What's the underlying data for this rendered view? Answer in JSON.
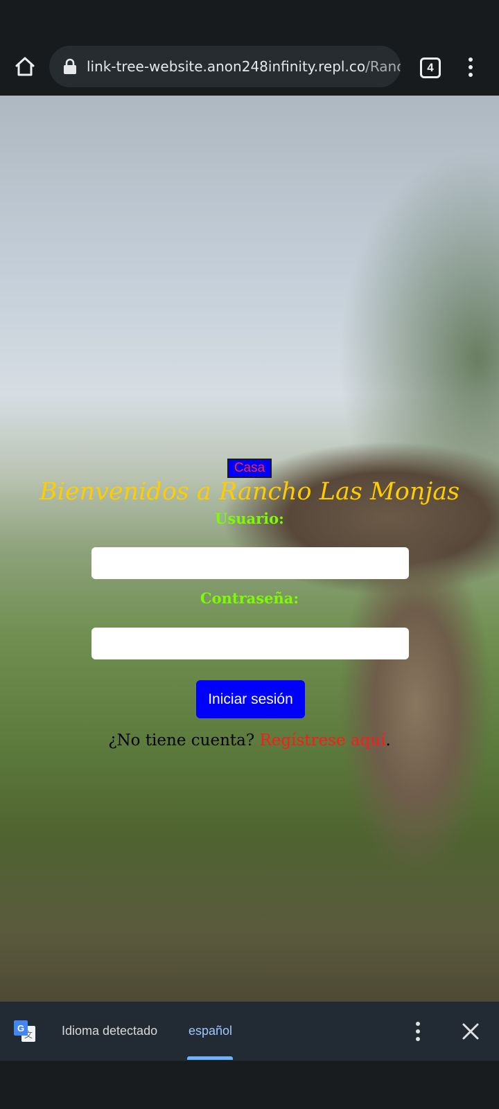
{
  "browser": {
    "url_host": "link-tree-website.anon248infinity.repl.co",
    "url_path": "/Rancho",
    "tab_count": "4",
    "icons": {
      "home": "home-icon",
      "lock": "lock-icon",
      "tabs": "tab-switcher-icon",
      "menu": "more-vert-icon"
    }
  },
  "page": {
    "home_button": "Casa",
    "title": "Bienvenidos a Rancho Las Monjas",
    "username_label": "Usuario:",
    "username_value": "",
    "password_label": "Contraseña:",
    "password_value": "",
    "login_button": "Iniciar sesión",
    "signup_prefix": "¿No tiene cuenta? ",
    "signup_link": "Regístrese aquí",
    "signup_suffix": "."
  },
  "translate_bar": {
    "detected_label": "Idioma detectado",
    "language": "español",
    "icons": {
      "logo": "google-translate-icon",
      "more": "more-vert-icon",
      "close": "close-icon"
    }
  },
  "colors": {
    "title": "#ffcc00",
    "labels": "#7cfc00",
    "button_bg": "#0000ff",
    "link": "#ff1a1a",
    "casa_text": "#ff2a2a"
  }
}
